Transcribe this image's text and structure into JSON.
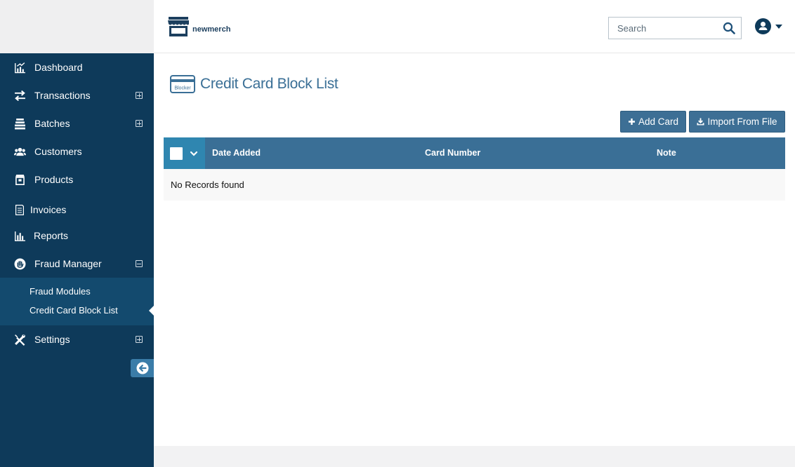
{
  "brand": {
    "name": "newmerch",
    "icon": "storefront-icon"
  },
  "header": {
    "search_placeholder": "Search",
    "search_icon": "search-icon",
    "user_icon": "user-circle-icon"
  },
  "sidebar": {
    "items": [
      {
        "label": "Dashboard",
        "icon": "dashboard-chart-icon",
        "toggle": ""
      },
      {
        "label": "Transactions",
        "icon": "arrows-exchange-icon",
        "toggle": "plus"
      },
      {
        "label": "Batches",
        "icon": "stack-icon",
        "toggle": "plus"
      },
      {
        "label": "Customers",
        "icon": "users-group-icon",
        "toggle": ""
      },
      {
        "label": "Products",
        "icon": "box-icon",
        "toggle": ""
      },
      {
        "label": "Invoices",
        "icon": "document-icon",
        "toggle": ""
      },
      {
        "label": "Reports",
        "icon": "bar-chart-icon",
        "toggle": ""
      },
      {
        "label": "Fraud Manager",
        "icon": "hand-stop-icon",
        "toggle": "minus"
      },
      {
        "label": "Settings",
        "icon": "tools-icon",
        "toggle": "plus"
      }
    ],
    "fraud_subitems": [
      {
        "label": "Fraud Modules"
      },
      {
        "label": "Credit Card Block List"
      }
    ],
    "collapse_icon": "arrow-left-circle-icon"
  },
  "page": {
    "title": "Credit Card Block List",
    "title_icon_text": "Blocker",
    "buttons": {
      "add": "Add Card",
      "import": "Import From File"
    }
  },
  "table": {
    "columns": [
      "Date Added",
      "Card Number",
      "Note"
    ],
    "empty_message": "No Records found"
  },
  "colors": {
    "sidebar_bg": "#0e3a5a",
    "submenu_bg": "#134a6e",
    "accent": "#3a6f96",
    "select_cell": "#2f86b0"
  }
}
